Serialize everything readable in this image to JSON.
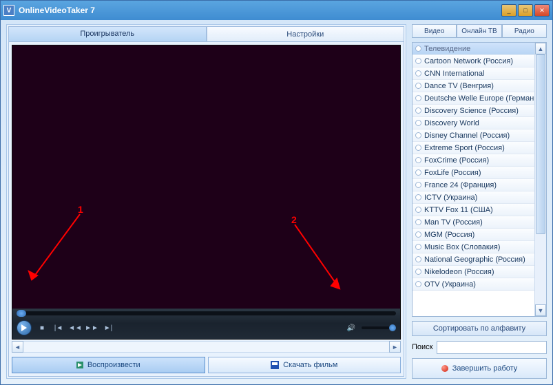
{
  "title": "OnlineVideoTaker 7",
  "main_tabs": {
    "player": "Проигрыватель",
    "settings": "Настройки"
  },
  "annotations": {
    "one": "1",
    "two": "2"
  },
  "buttons": {
    "play": "Воспроизвести",
    "download": "Скачать фильм"
  },
  "right_tabs": {
    "video": "Видео",
    "online_tv": "Онлайн ТВ",
    "radio": "Радио"
  },
  "channels": [
    "Телевидение",
    "Cartoon Network (Россия)",
    "CNN International",
    "Dance TV (Венгрия)",
    "Deutsche Welle Europe (Германия)",
    "Discovery Science (Россия)",
    "Discovery World",
    "Disney Channel (Россия)",
    "Extreme Sport (Россия)",
    "FoxCrime (Россия)",
    "FoxLife (Россия)",
    "France 24 (Франция)",
    "ICTV (Украина)",
    "KTTV Fox 11 (США)",
    "Man TV (Россия)",
    "MGM (Россия)",
    "Music Box (Словакия)",
    "National Geographic (Россия)",
    "Nikelodeon (Россия)",
    "OTV (Украина)"
  ],
  "sort_label": "Сортировать по алфавиту",
  "search_label": "Поиск",
  "quit_label": "Завершить работу"
}
